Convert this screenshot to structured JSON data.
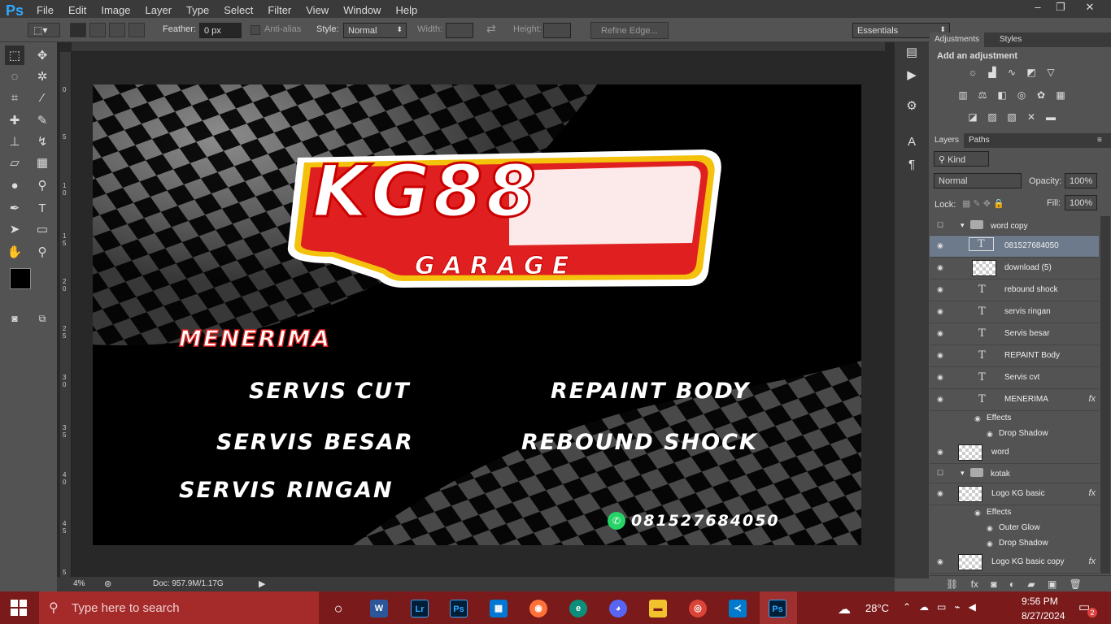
{
  "app": {
    "logo": "Ps"
  },
  "menu": [
    "File",
    "Edit",
    "Image",
    "Layer",
    "Type",
    "Select",
    "Filter",
    "View",
    "Window",
    "Help"
  ],
  "window_controls": {
    "minimize": "–",
    "restore": "❐",
    "close": "✕"
  },
  "options": {
    "feather_label": "Feather:",
    "feather_value": "0 px",
    "antialias_label": "Anti-alias",
    "style_label": "Style:",
    "style_value": "Normal",
    "width_label": "Width:",
    "height_label": "Height:",
    "refine_label": "Refine Edge...",
    "workspace": "Essentials"
  },
  "ruler_left_labels": [
    "0",
    "5",
    "1\n0",
    "1\n5",
    "2\n0",
    "2\n5",
    "3\n0",
    "3\n5",
    "4\n0",
    "4\n5",
    "5"
  ],
  "document": {
    "logo_main": "KG88",
    "logo_sub": "GARAGE",
    "heading": "MENERIMA",
    "services": [
      "SERVIS CUT",
      "REPAINT BODY",
      "SERVIS BESAR",
      "REBOUND SHOCK",
      "SERVIS RINGAN"
    ],
    "phone": "081527684050"
  },
  "status": {
    "zoom": "4%",
    "doc": "Doc: 957.9M/1.17G"
  },
  "adjust": {
    "tab_adjust": "Adjustments",
    "tab_styles": "Styles",
    "title": "Add an adjustment"
  },
  "layers_panel": {
    "tab_layers": "Layers",
    "tab_paths": "Paths",
    "kind": "Kind",
    "blend": "Normal",
    "opacity_label": "Opacity:",
    "opacity_value": "100%",
    "lock_label": "Lock:",
    "fill_label": "Fill:",
    "fill_value": "100%"
  },
  "layers": [
    {
      "name": "word copy",
      "type": "group"
    },
    {
      "name": "081527684050",
      "type": "text",
      "selected": true
    },
    {
      "name": "download (5)",
      "type": "image"
    },
    {
      "name": "rebound shock",
      "type": "text"
    },
    {
      "name": "servis ringan",
      "type": "text"
    },
    {
      "name": "Servis besar",
      "type": "text"
    },
    {
      "name": "REPAINT Body",
      "type": "text"
    },
    {
      "name": "Servis cvt",
      "type": "text"
    },
    {
      "name": "MENERIMA",
      "type": "text",
      "fx": true
    },
    {
      "name": "Effects",
      "type": "effect"
    },
    {
      "name": "Drop Shadow",
      "type": "effect"
    },
    {
      "name": "word",
      "type": "image"
    },
    {
      "name": "kotak",
      "type": "group"
    },
    {
      "name": "Logo KG basic",
      "type": "image",
      "fx": true
    },
    {
      "name": "Effects",
      "type": "effect"
    },
    {
      "name": "Outer Glow",
      "type": "effect"
    },
    {
      "name": "Drop Shadow",
      "type": "effect"
    },
    {
      "name": "Logo KG basic copy",
      "type": "image",
      "fx": true
    }
  ],
  "taskbar": {
    "search_placeholder": "Type here to search",
    "weather": "28°C",
    "time": "9:56 PM",
    "date": "8/27/2024",
    "notifications": "2",
    "apps": [
      "word-icon",
      "lightroom-icon",
      "photoshop-icon",
      "store-icon",
      "firefox-icon",
      "edge-icon",
      "discord-icon",
      "file-explorer-icon",
      "chrome-icon",
      "vscode-icon",
      "photoshop-active-icon"
    ]
  },
  "colors": {
    "accent": "#31a8ff",
    "taskbar": "#7b1a1a",
    "logo_red": "#e02020",
    "logo_yellow": "#f4c20d"
  }
}
